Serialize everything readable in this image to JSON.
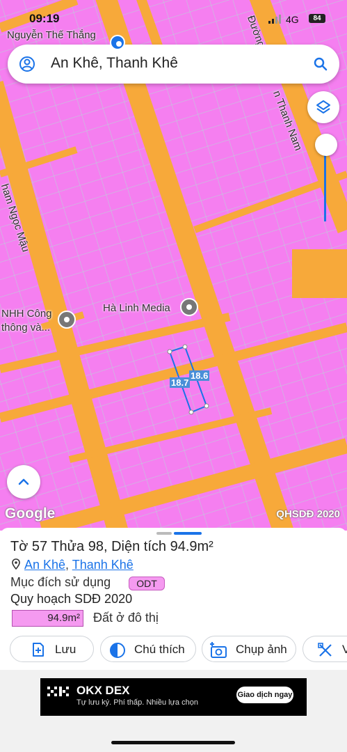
{
  "status": {
    "time": "09:19",
    "network": "4G",
    "battery": "84"
  },
  "map": {
    "streets": [
      "Nguyễn Thế Thắng",
      "Đường",
      "n Thanh Nam",
      "ham Ngọc Mậu"
    ],
    "pois": [
      "Hà Linh Media",
      "NHH Công",
      "thông và..."
    ],
    "measurements": [
      "18.7",
      "18.6"
    ],
    "google_label": "Google",
    "layer_label": "QHSDĐ 2020"
  },
  "search": {
    "query": "An Khê, Thanh Khê"
  },
  "parcel": {
    "title": "Tờ 57 Thửa 98, Diện tích 94.9m²",
    "location_parts": [
      "An Khê",
      "Thanh Khê"
    ],
    "separator": ",",
    "purpose_label": "Mục đích sử dụng",
    "purpose_code": "ODT",
    "plan_title": "Quy hoạch SDĐ 2020",
    "plan_area": "94.9m²",
    "plan_desc": "Đất ở đô thị",
    "plan_color": "#f59af0"
  },
  "actions": [
    {
      "label": "Lưu",
      "icon": "add-note-icon"
    },
    {
      "label": "Chú thích",
      "icon": "contrast-icon"
    },
    {
      "label": "Chụp ảnh",
      "icon": "camera-add-icon"
    },
    {
      "label": "V",
      "icon": "measure-icon"
    }
  ],
  "ad": {
    "brand": "OKX DEX",
    "tagline": "Tự lưu ký. Phí thấp. Nhiều lựa chọn",
    "cta": "Giao dịch ngay"
  }
}
